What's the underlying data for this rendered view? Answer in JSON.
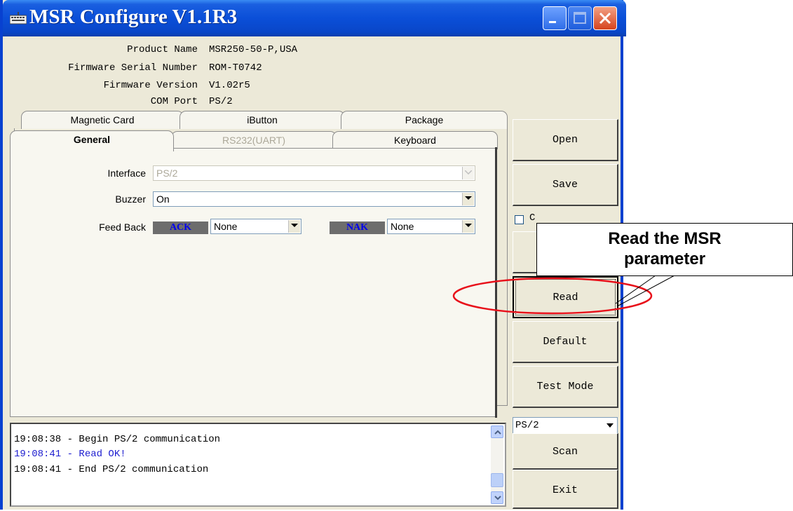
{
  "window": {
    "title": "MSR Configure V1.1R3",
    "controls": [
      "minimize-icon",
      "maximize-icon",
      "close-icon"
    ]
  },
  "info": {
    "product_name_label": "Product Name",
    "product_name": "MSR250-50-P,USA",
    "firmware_serial_label": "Firmware Serial Number",
    "firmware_serial": "ROM-T0742",
    "firmware_version_label": "Firmware Version",
    "firmware_version": "V1.02r5",
    "com_port_label": "COM Port",
    "com_port": "PS/2"
  },
  "tabs": {
    "row1": [
      "Magnetic Card",
      "iButton",
      "Package"
    ],
    "row2": [
      "General",
      "RS232(UART)",
      "Keyboard"
    ],
    "active": "General"
  },
  "general": {
    "interface_label": "Interface",
    "interface_value": "PS/2",
    "buzzer_label": "Buzzer",
    "buzzer_value": "On",
    "feedback_label": "Feed Back",
    "ack_label": "ACK",
    "ack_value": "None",
    "nak_label": "NAK",
    "nak_value": "None"
  },
  "buttons": {
    "open": "Open",
    "save": "Save",
    "read": "Read",
    "default": "Default",
    "test_mode": "Test Mode",
    "scan": "Scan",
    "exit": "Exit"
  },
  "checkbox": {
    "label": "C",
    "checked": false
  },
  "port_select": {
    "value": "PS/2"
  },
  "log": [
    {
      "text": "19:08:38 - Begin PS/2 communication",
      "color": "#000000"
    },
    {
      "text": "19:08:41 - Read OK!",
      "color": "#2020d0"
    },
    {
      "text": "19:08:41 - End PS/2 communication",
      "color": "#000000"
    }
  ],
  "annotation": {
    "callout_line1": "Read the MSR",
    "callout_line2": "parameter",
    "highlight_color": "#e8101a"
  }
}
